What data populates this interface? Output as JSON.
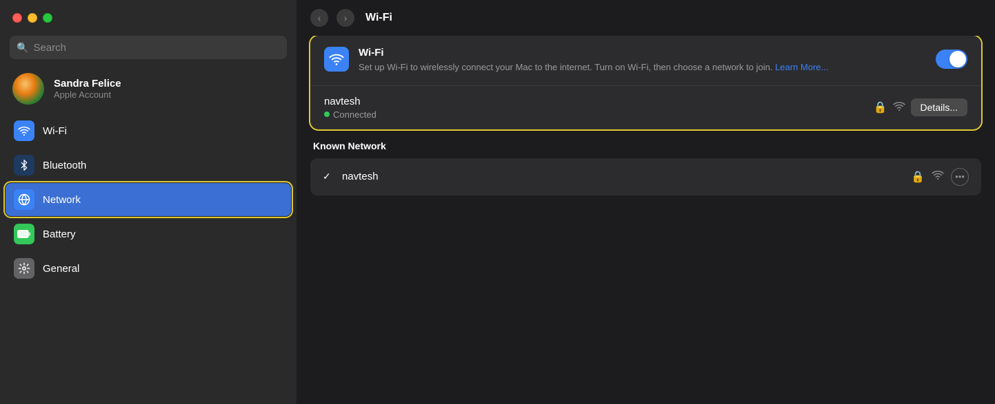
{
  "window": {
    "title": "Wi-Fi"
  },
  "sidebar": {
    "search_placeholder": "Search",
    "user": {
      "name": "Sandra Felice",
      "subtitle": "Apple Account"
    },
    "items": [
      {
        "id": "wifi",
        "label": "Wi-Fi",
        "icon": "wifi",
        "active": false
      },
      {
        "id": "bluetooth",
        "label": "Bluetooth",
        "icon": "bluetooth",
        "active": false
      },
      {
        "id": "network",
        "label": "Network",
        "icon": "network",
        "active": true
      },
      {
        "id": "battery",
        "label": "Battery",
        "icon": "battery",
        "active": false
      },
      {
        "id": "general",
        "label": "General",
        "icon": "general",
        "active": false
      }
    ]
  },
  "main": {
    "title": "Wi-Fi",
    "wifi_section": {
      "title": "Wi-Fi",
      "description": "Set up Wi-Fi to wirelessly connect your Mac to the internet. Turn on Wi-Fi, then choose a network to join.",
      "learn_more": "Learn More...",
      "toggle_on": true,
      "network_ssid": "navtesh",
      "connected_label": "Connected",
      "details_button": "Details..."
    },
    "known_network": {
      "section_title": "Known Network",
      "ssid": "navtesh"
    }
  },
  "nav": {
    "back_label": "‹",
    "forward_label": "›"
  }
}
